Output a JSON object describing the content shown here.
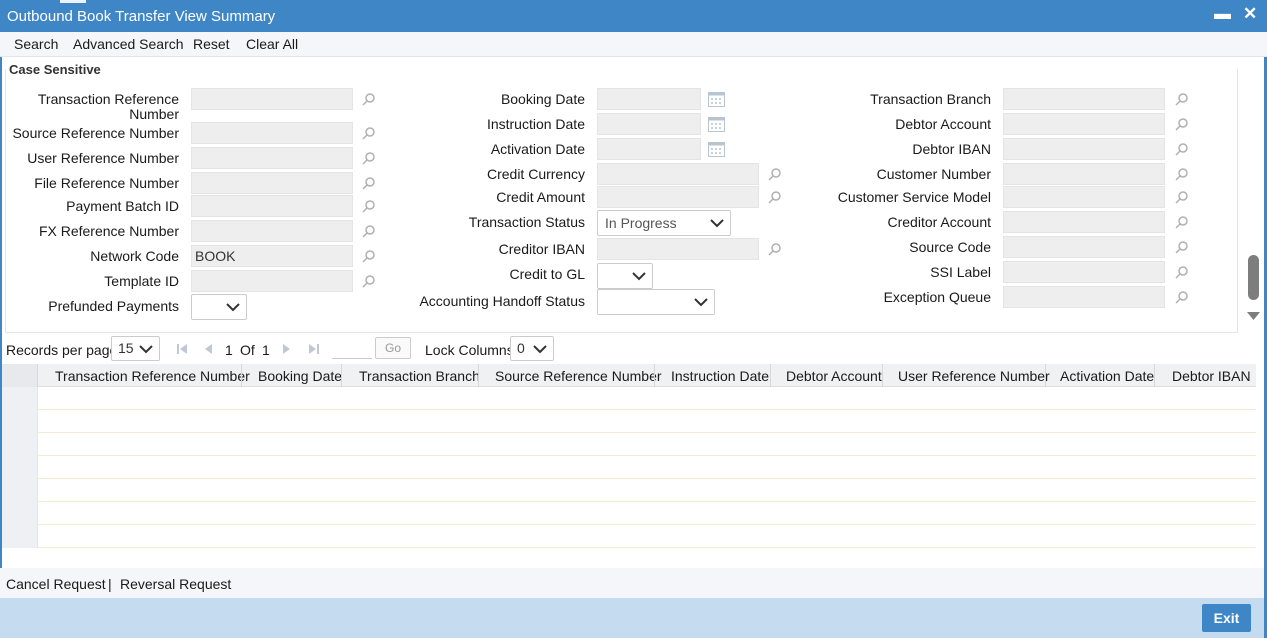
{
  "window": {
    "title": "Outbound Book Transfer View Summary",
    "minimize": "▬",
    "close": "✕"
  },
  "toolbar": {
    "search": "Search",
    "advanced_search": "Advanced Search",
    "reset": "Reset",
    "clear_all": "Clear All"
  },
  "form": {
    "section_label": "Case Sensitive",
    "col1": {
      "transaction_reference_number": "Transaction Reference Number",
      "source_reference_number": "Source Reference Number",
      "user_reference_number": "User Reference Number",
      "file_reference_number": "File Reference Number",
      "payment_batch_id": "Payment Batch ID",
      "fx_reference_number": "FX Reference Number",
      "network_code": "Network Code",
      "network_code_value": "BOOK",
      "template_id": "Template ID",
      "prefunded_payments": "Prefunded Payments"
    },
    "col2": {
      "booking_date": "Booking Date",
      "instruction_date": "Instruction Date",
      "activation_date": "Activation Date",
      "credit_currency": "Credit Currency",
      "credit_amount": "Credit Amount",
      "transaction_status": "Transaction Status",
      "transaction_status_value": "In Progress",
      "creditor_iban": "Creditor IBAN",
      "credit_to_gl": "Credit to GL",
      "accounting_handoff_status": "Accounting Handoff Status"
    },
    "col3": {
      "transaction_branch": "Transaction Branch",
      "debtor_account": "Debtor Account",
      "debtor_iban": "Debtor IBAN",
      "customer_number": "Customer Number",
      "customer_service_model": "Customer Service Model",
      "creditor_account": "Creditor Account",
      "source_code": "Source Code",
      "ssi_label": "SSI Label",
      "exception_queue": "Exception Queue"
    }
  },
  "pager": {
    "records_per_page_label": "Records per page",
    "records_per_page_value": "15",
    "current_page": "1",
    "of_label": "Of",
    "total_pages": "1",
    "go_label": "Go",
    "lock_columns_label": "Lock Columns",
    "lock_columns_value": "0"
  },
  "grid": {
    "columns": [
      "Transaction Reference Number",
      "Booking Date",
      "Transaction Branch",
      "Source Reference Number",
      "Instruction Date",
      "Debtor Account",
      "User Reference Number",
      "Activation Date",
      "Debtor IBAN"
    ]
  },
  "footer": {
    "cancel_request": "Cancel Request",
    "separator": "|",
    "reversal_request": "Reversal Request",
    "exit": "Exit"
  },
  "colors": {
    "accent": "#3f86c6",
    "bottom_bar": "#c5dcf0",
    "field_bg": "#eeeeee"
  }
}
